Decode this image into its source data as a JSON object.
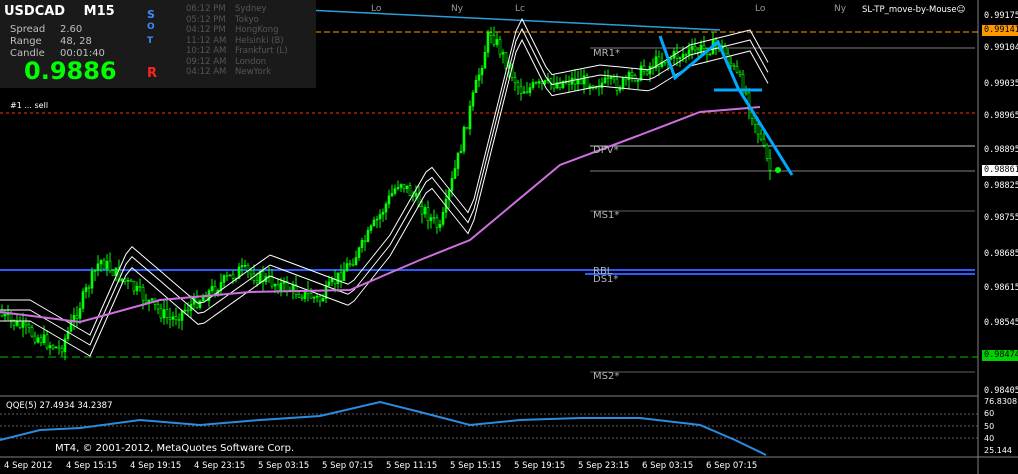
{
  "info": {
    "symbol": "USDCAD",
    "timeframe": "M15",
    "spread_label": "Spread",
    "spread_value": "2.60",
    "range_label": "Range",
    "range_value": "48, 28",
    "candle_label": "Candle",
    "candle_value": "00:01:40",
    "bid_price": "0.9886"
  },
  "sotr": [
    "S",
    "O",
    "T",
    "R"
  ],
  "sessions": [
    {
      "time": "06:12 PM",
      "city": "Sydney"
    },
    {
      "time": "05:12 PM",
      "city": "Tokyo"
    },
    {
      "time": "04:12 PM",
      "city": "HongKong"
    },
    {
      "time": "11:12 AM",
      "city": "Helsinki  (B)"
    },
    {
      "time": "10:12 AM",
      "city": "Frankfurt  (L)"
    },
    {
      "time": "09:12 AM",
      "city": "London"
    },
    {
      "time": "04:12 AM",
      "city": "NewYork"
    }
  ],
  "session_markers": [
    {
      "label": "Lo"
    },
    {
      "label": "Ny"
    },
    {
      "label": "Lc"
    },
    {
      "label": "Lo"
    },
    {
      "label": "Ny"
    }
  ],
  "sltp_label": "SL-TP_move-by-Mouse☺",
  "trade_label": "#1 ... sell",
  "pivots": {
    "mr1": "MR1*",
    "dpv": "DPV*",
    "ms1": "MS1*",
    "rbl": "RBL",
    "ds1": "DS1*",
    "ms2": "MS2*"
  },
  "price_axis": [
    "0.99175",
    "0.99104",
    "0.99035",
    "0.98965",
    "0.98895",
    "0.98825",
    "0.98755",
    "0.98685",
    "0.98615",
    "0.98545",
    "0.98475",
    "0.98405"
  ],
  "price_boxes": {
    "orange": "0.99141",
    "white": "0.98861",
    "green": "0.98474"
  },
  "qqe": {
    "label": "QQE(5) 27.4934 34.2387",
    "axis": [
      "76.8308",
      "60",
      "50",
      "40",
      "25.144"
    ]
  },
  "copyright": "MT4, © 2001-2012, MetaQuotes Software Corp.",
  "time_axis": [
    "4 Sep 2012",
    "4 Sep 15:15",
    "4 Sep 19:15",
    "4 Sep 23:15",
    "5 Sep 03:15",
    "5 Sep 07:15",
    "5 Sep 11:15",
    "5 Sep 15:15",
    "5 Sep 19:15",
    "5 Sep 23:15",
    "6 Sep 03:15",
    "6 Sep 07:15"
  ],
  "colors": {
    "candle_bull": "#00ff00",
    "ma_white": "#ffffff",
    "ma_violet": "#d070e0",
    "trend": "#00a8ff",
    "orange_line": "#ff9900",
    "red_line": "#ff3300",
    "green_dash": "#00c000",
    "blue_line": "#2a5cff"
  }
}
